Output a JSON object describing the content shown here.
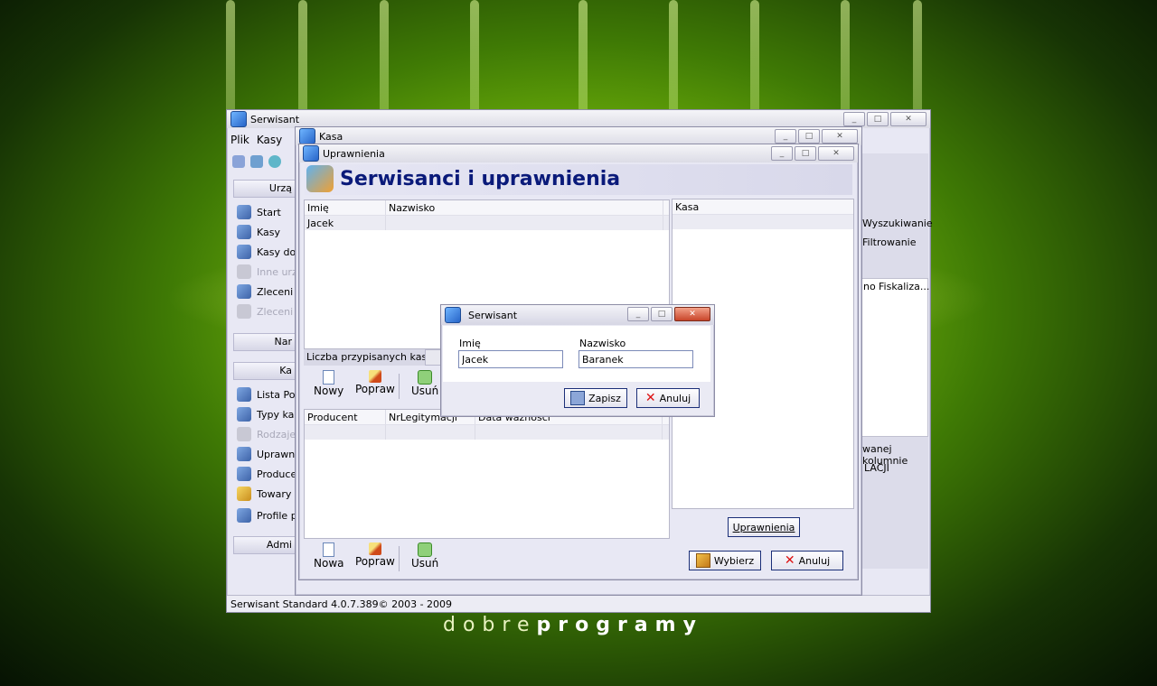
{
  "desktop": {
    "watermark_part1": "dobre",
    "watermark_part2": "programy"
  },
  "main_window": {
    "title": "Serwisant",
    "menu": [
      "Plik",
      "Kasy"
    ],
    "sidebar_groups": [
      "Urzą",
      "Nar",
      "Ka",
      "Admi"
    ],
    "sidebar_items_top": [
      {
        "label": "Start",
        "enabled": true
      },
      {
        "label": "Kasy",
        "enabled": true
      },
      {
        "label": "Kasy do",
        "enabled": true
      },
      {
        "label": "Inne urz",
        "enabled": false
      },
      {
        "label": "Zleceni",
        "enabled": true
      },
      {
        "label": "Zleceni",
        "enabled": false
      }
    ],
    "sidebar_items_bottom": [
      {
        "label": "Lista Po",
        "enabled": true
      },
      {
        "label": "Typy ka",
        "enabled": true
      },
      {
        "label": "Rodzaje",
        "enabled": false
      },
      {
        "label": "Uprawn",
        "enabled": true
      },
      {
        "label": "Produce",
        "enabled": true
      },
      {
        "label": "Towary",
        "enabled": true
      },
      {
        "label": "Profile p",
        "enabled": true
      }
    ],
    "right_fragments": {
      "search": "Wyszukiwanie",
      "filter": "Filtrowanie",
      "col_a": "no",
      "col_b": "Fiskaliza...",
      "col_hint": "wanej kolumnie",
      "section": "LACJI"
    },
    "status_text": "Serwisant Standard 4.0.7.389© 2003 - 2009"
  },
  "kasa_window": {
    "title": "Kasa"
  },
  "uprawnienia_window": {
    "title": "Uprawnienia",
    "header": "Serwisanci i uprawnienia",
    "serwisanci_grid": {
      "columns": [
        "Imię",
        "Nazwisko"
      ],
      "rows": [
        [
          "Jacek",
          ""
        ]
      ]
    },
    "assigned_label": "Liczba przypisanych kas:",
    "assigned_value": "",
    "toolbar_top": [
      "Nowy",
      "Popraw",
      "Usuń"
    ],
    "legitymacje_grid": {
      "columns": [
        "Producent",
        "NrLegitymacji",
        "Data ważności"
      ],
      "rows": [
        [
          "",
          "",
          ""
        ]
      ]
    },
    "toolbar_bottom": [
      "Nowa",
      "Popraw",
      "Usuń"
    ],
    "kasa_grid": {
      "columns": [
        "Kasa"
      ]
    },
    "uprawnienia_button": "Uprawnienia",
    "wybierz_button": "Wybierz",
    "anuluj_button": "Anuluj"
  },
  "serwisant_dialog": {
    "title": "Serwisant",
    "first_name_label": "Imię",
    "first_name_value": "Jacek",
    "last_name_label": "Nazwisko",
    "last_name_value": "Baranek",
    "save_button": "Zapisz",
    "cancel_button": "Anuluj"
  }
}
